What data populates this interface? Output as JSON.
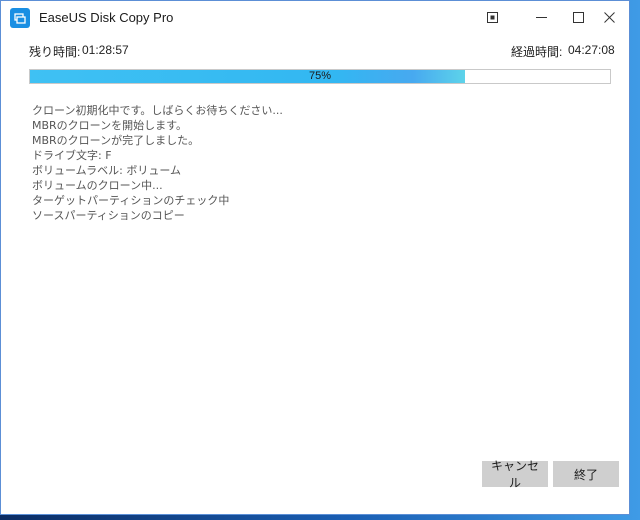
{
  "window": {
    "title": "EaseUS Disk Copy Pro"
  },
  "timers": {
    "remaining_label": "残り時間:",
    "remaining_value": "01:28:57",
    "elapsed_label": "経過時間:",
    "elapsed_value": "04:27:08"
  },
  "progress": {
    "percent": 75,
    "label": "75%"
  },
  "log": [
    "クローン初期化中です。しばらくお待ちください...",
    "MBRのクローンを開始します。",
    "MBRのクローンが完了しました。",
    "ドライブ文字: F",
    "ボリュームラベル: ボリューム",
    "ボリュームのクローン中...",
    "ターゲットパーティションのチェック中",
    "ソースパーティションのコピー"
  ],
  "buttons": {
    "cancel": "キャンセル",
    "finish": "終了"
  },
  "colors": {
    "accent": "#3fc1f3",
    "button_bg": "#cfcfcf"
  },
  "icons": {
    "app": "easeus-disk-copy-icon",
    "pin": "pin-icon",
    "minimize": "minimize-icon",
    "maximize": "maximize-icon",
    "close": "close-icon"
  }
}
